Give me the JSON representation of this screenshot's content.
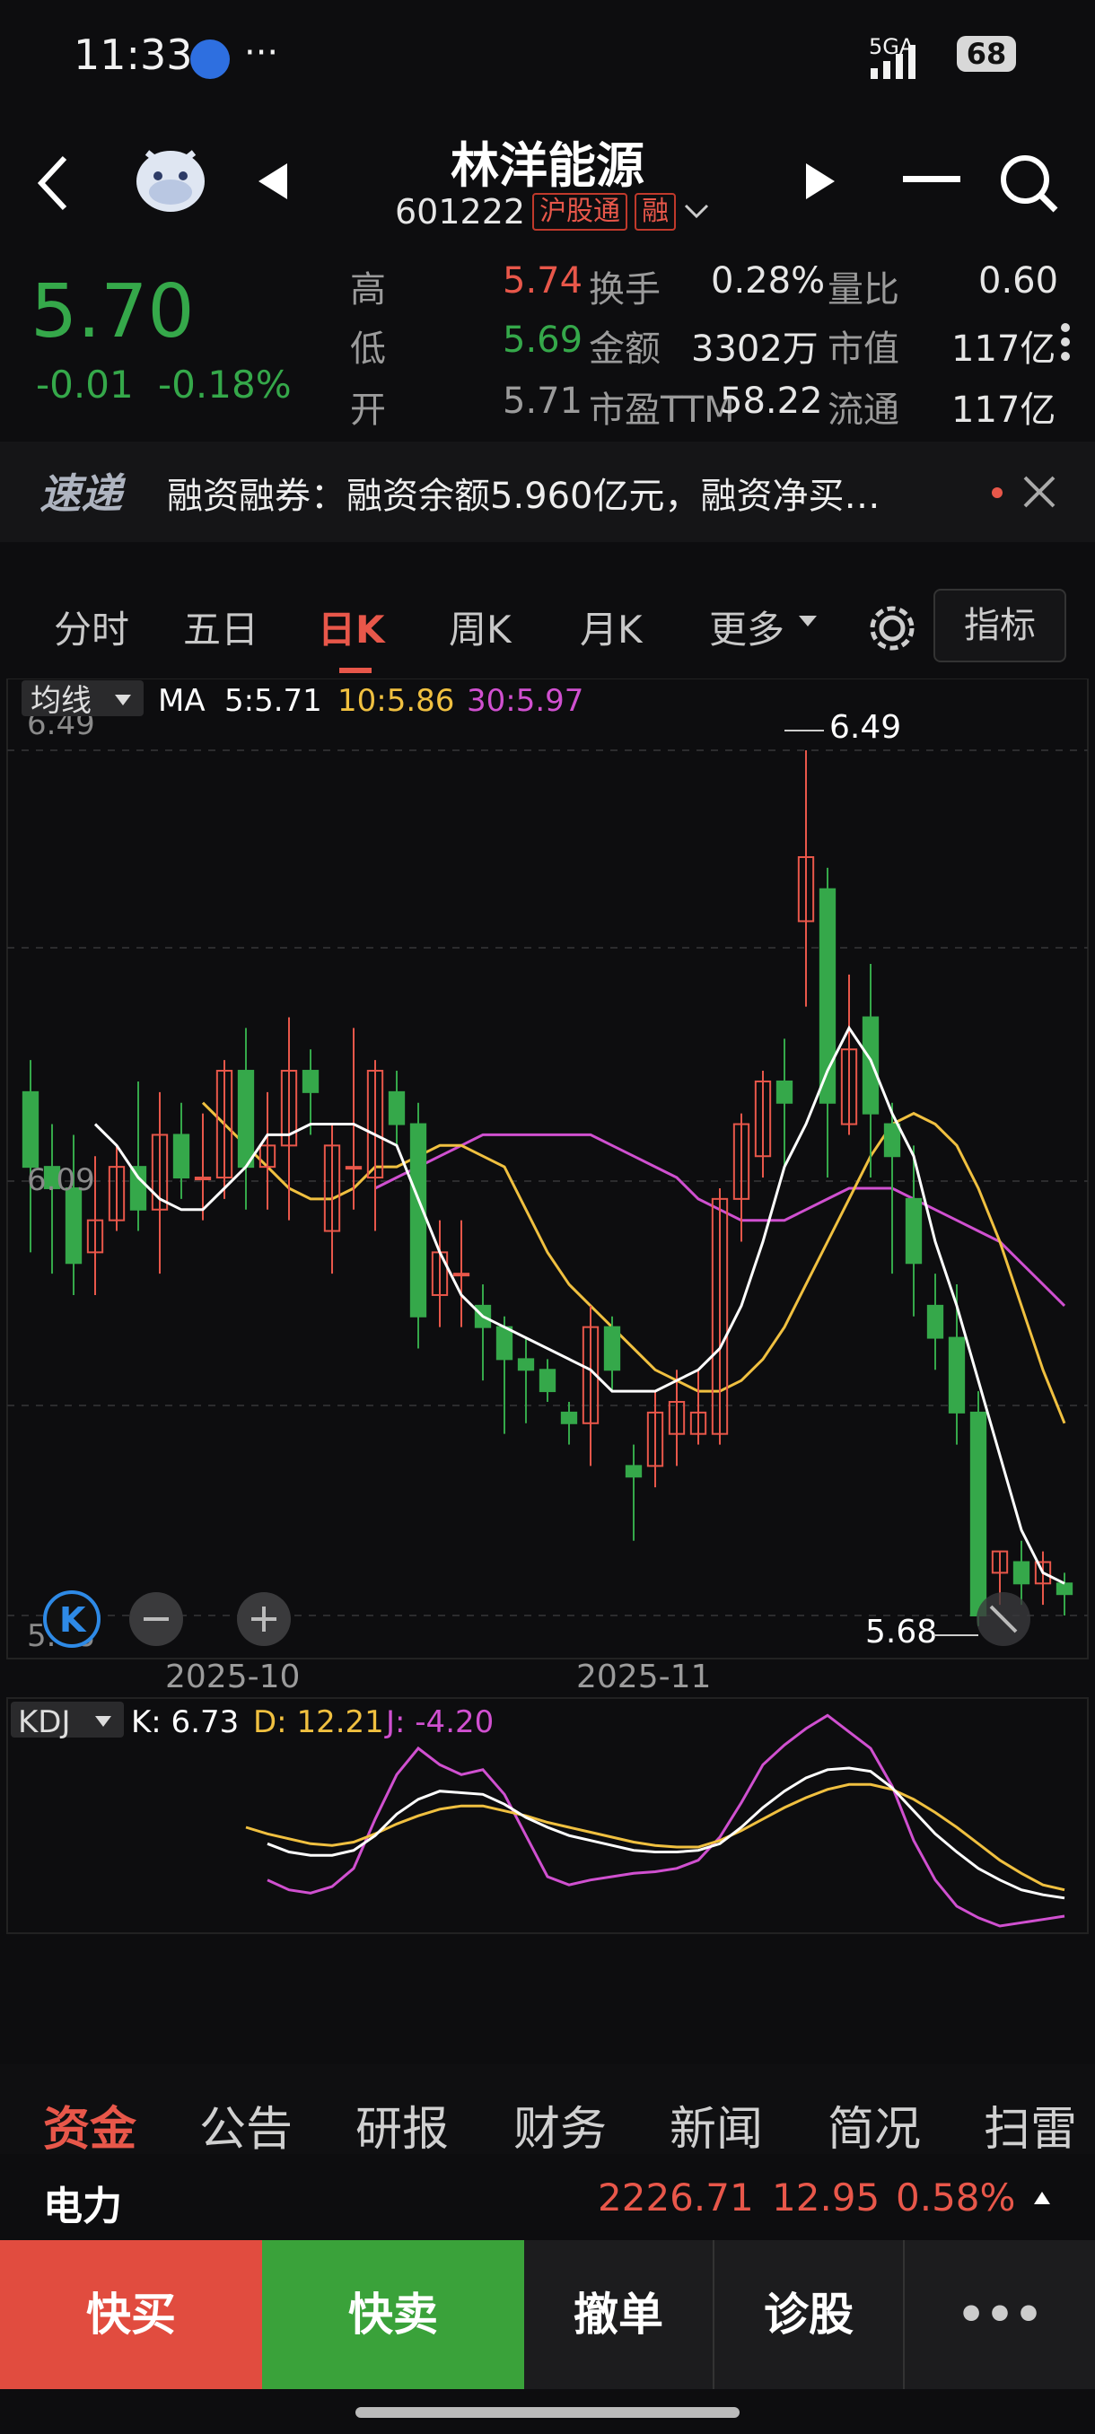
{
  "status_bar": {
    "time": "11:33",
    "dots": "···",
    "network": "5GA",
    "battery": "68"
  },
  "header": {
    "title": "林洋能源",
    "code": "601222",
    "tag_hgt": "沪股通",
    "tag_rong": "融"
  },
  "quote": {
    "price": "5.70",
    "change": "-0.01",
    "change_pct": "-0.18%",
    "rows": [
      {
        "l1": "高",
        "v1": "5.74",
        "l2": "换手",
        "v2": "0.28%",
        "l3": "量比",
        "v3": "0.60"
      },
      {
        "l1": "低",
        "v1": "5.69",
        "l2": "金额",
        "v2": "3302万",
        "l3": "市值",
        "v3": "117亿"
      },
      {
        "l1": "开",
        "v1": "5.71",
        "l2": "市盈TTM",
        "v2": "58.22",
        "l3": "流通",
        "v3": "117亿"
      }
    ]
  },
  "news": {
    "logo": "速递",
    "text": "融资融券：融资余额5.960亿元，融资净买…"
  },
  "tabs": {
    "items": [
      "分时",
      "五日",
      "日K",
      "周K",
      "月K",
      "更多"
    ],
    "active": "日K",
    "indicator_button": "指标"
  },
  "ma_legend": {
    "label": "均线",
    "ma": "MA",
    "ma5": "5:5.71",
    "ma10": "10:5.86",
    "ma30": "30:5.97"
  },
  "kdj_legend": {
    "label": "KDJ",
    "k": "K: 6.73",
    "d": "D: 12.21",
    "j": "J: -4.20"
  },
  "chart_data": {
    "type": "candlestick",
    "y_labels": [
      "6.49",
      "6.09",
      "5.68"
    ],
    "x_labels": [
      "2025-10",
      "2025-11"
    ],
    "annotations": {
      "high": "6.49",
      "low": "5.68"
    },
    "ylim": [
      5.68,
      6.49
    ],
    "colors": {
      "up": "#e8574a",
      "down": "#35a84a",
      "ma5": "#ffffff",
      "ma10": "#f0c040",
      "ma30": "#d050d0"
    },
    "candles": [
      {
        "o": 6.17,
        "h": 6.2,
        "l": 6.02,
        "c": 6.1
      },
      {
        "o": 6.1,
        "h": 6.14,
        "l": 6.0,
        "c": 6.08
      },
      {
        "o": 6.08,
        "h": 6.13,
        "l": 5.98,
        "c": 6.01
      },
      {
        "o": 6.02,
        "h": 6.11,
        "l": 5.98,
        "c": 6.05
      },
      {
        "o": 6.05,
        "h": 6.12,
        "l": 6.04,
        "c": 6.1
      },
      {
        "o": 6.1,
        "h": 6.18,
        "l": 6.04,
        "c": 6.06
      },
      {
        "o": 6.06,
        "h": 6.17,
        "l": 6.0,
        "c": 6.13
      },
      {
        "o": 6.13,
        "h": 6.16,
        "l": 6.07,
        "c": 6.09
      },
      {
        "o": 6.09,
        "h": 6.15,
        "l": 6.05,
        "c": 6.09
      },
      {
        "o": 6.09,
        "h": 6.2,
        "l": 6.07,
        "c": 6.19
      },
      {
        "o": 6.19,
        "h": 6.23,
        "l": 6.06,
        "c": 6.1
      },
      {
        "o": 6.1,
        "h": 6.17,
        "l": 6.06,
        "c": 6.12
      },
      {
        "o": 6.12,
        "h": 6.24,
        "l": 6.05,
        "c": 6.19
      },
      {
        "o": 6.19,
        "h": 6.21,
        "l": 6.13,
        "c": 6.17
      },
      {
        "o": 6.04,
        "h": 6.14,
        "l": 6.0,
        "c": 6.12
      },
      {
        "o": 6.1,
        "h": 6.23,
        "l": 6.06,
        "c": 6.1
      },
      {
        "o": 6.09,
        "h": 6.2,
        "l": 6.04,
        "c": 6.19
      },
      {
        "o": 6.17,
        "h": 6.19,
        "l": 6.12,
        "c": 6.14
      },
      {
        "o": 6.14,
        "h": 6.16,
        "l": 5.93,
        "c": 5.96
      },
      {
        "o": 5.98,
        "h": 6.05,
        "l": 5.95,
        "c": 6.02
      },
      {
        "o": 6.0,
        "h": 6.05,
        "l": 5.95,
        "c": 6.0
      },
      {
        "o": 5.97,
        "h": 5.99,
        "l": 5.9,
        "c": 5.95
      },
      {
        "o": 5.95,
        "h": 5.96,
        "l": 5.85,
        "c": 5.92
      },
      {
        "o": 5.92,
        "h": 5.94,
        "l": 5.86,
        "c": 5.91
      },
      {
        "o": 5.91,
        "h": 5.92,
        "l": 5.88,
        "c": 5.89
      },
      {
        "o": 5.87,
        "h": 5.88,
        "l": 5.84,
        "c": 5.86
      },
      {
        "o": 5.86,
        "h": 5.97,
        "l": 5.82,
        "c": 5.95
      },
      {
        "o": 5.95,
        "h": 5.96,
        "l": 5.89,
        "c": 5.91
      },
      {
        "o": 5.82,
        "h": 5.84,
        "l": 5.75,
        "c": 5.81
      },
      {
        "o": 5.82,
        "h": 5.89,
        "l": 5.8,
        "c": 5.87
      },
      {
        "o": 5.85,
        "h": 5.91,
        "l": 5.82,
        "c": 5.88
      },
      {
        "o": 5.85,
        "h": 5.91,
        "l": 5.84,
        "c": 5.87
      },
      {
        "o": 5.85,
        "h": 6.08,
        "l": 5.84,
        "c": 6.07
      },
      {
        "o": 6.07,
        "h": 6.15,
        "l": 6.03,
        "c": 6.14
      },
      {
        "o": 6.11,
        "h": 6.19,
        "l": 6.09,
        "c": 6.18
      },
      {
        "o": 6.18,
        "h": 6.22,
        "l": 6.1,
        "c": 6.16
      },
      {
        "o": 6.33,
        "h": 6.49,
        "l": 6.25,
        "c": 6.39
      },
      {
        "o": 6.36,
        "h": 6.38,
        "l": 6.09,
        "c": 6.16
      },
      {
        "o": 6.14,
        "h": 6.28,
        "l": 6.13,
        "c": 6.21
      },
      {
        "o": 6.24,
        "h": 6.29,
        "l": 6.09,
        "c": 6.15
      },
      {
        "o": 6.14,
        "h": 6.16,
        "l": 6.0,
        "c": 6.11
      },
      {
        "o": 6.07,
        "h": 6.12,
        "l": 5.96,
        "c": 6.01
      },
      {
        "o": 5.97,
        "h": 6.0,
        "l": 5.91,
        "c": 5.94
      },
      {
        "o": 5.94,
        "h": 5.99,
        "l": 5.84,
        "c": 5.87
      },
      {
        "o": 5.87,
        "h": 5.89,
        "l": 5.67,
        "c": 5.68
      },
      {
        "o": 5.72,
        "h": 5.74,
        "l": 5.69,
        "c": 5.74
      },
      {
        "o": 5.73,
        "h": 5.75,
        "l": 5.69,
        "c": 5.71
      },
      {
        "o": 5.71,
        "h": 5.74,
        "l": 5.69,
        "c": 5.73
      },
      {
        "o": 5.71,
        "h": 5.72,
        "l": 5.68,
        "c": 5.7
      }
    ],
    "ma5": [
      6.14,
      6.12,
      6.09,
      6.07,
      6.06,
      6.06,
      6.08,
      6.1,
      6.13,
      6.13,
      6.14,
      6.14,
      6.14,
      6.13,
      6.12,
      6.07,
      6.02,
      5.98,
      5.96,
      5.95,
      5.94,
      5.93,
      5.92,
      5.91,
      5.89,
      5.89,
      5.89,
      5.9,
      5.91,
      5.93,
      5.97,
      6.03,
      6.1,
      6.14,
      6.19,
      6.23,
      6.2,
      6.15,
      6.11,
      6.03,
      5.97,
      5.9,
      5.83,
      5.76,
      5.72,
      5.71
    ],
    "ma10": [
      6.16,
      6.14,
      6.12,
      6.1,
      6.08,
      6.07,
      6.07,
      6.08,
      6.1,
      6.1,
      6.11,
      6.12,
      6.12,
      6.11,
      6.1,
      6.06,
      6.02,
      5.99,
      5.97,
      5.95,
      5.93,
      5.91,
      5.9,
      5.89,
      5.89,
      5.9,
      5.92,
      5.95,
      5.99,
      6.03,
      6.07,
      6.11,
      6.14,
      6.15,
      6.14,
      6.12,
      6.08,
      6.03,
      5.97,
      5.91,
      5.86
    ],
    "ma30": [
      6.08,
      6.09,
      6.1,
      6.11,
      6.12,
      6.13,
      6.13,
      6.13,
      6.13,
      6.13,
      6.13,
      6.12,
      6.11,
      6.1,
      6.09,
      6.07,
      6.06,
      6.05,
      6.05,
      6.05,
      6.06,
      6.07,
      6.08,
      6.08,
      6.08,
      6.07,
      6.06,
      6.05,
      6.04,
      6.03,
      6.01,
      5.99,
      5.97
    ],
    "kdj": {
      "ylim": [
        -10,
        110
      ],
      "k": [
        40,
        35,
        33,
        33,
        36,
        45,
        58,
        67,
        72,
        71,
        70,
        64,
        56,
        50,
        45,
        42,
        39,
        36,
        35,
        35,
        36,
        40,
        50,
        62,
        72,
        80,
        85,
        86,
        84,
        74,
        60,
        46,
        35,
        25,
        18,
        12,
        9,
        7
      ],
      "d": [
        50,
        46,
        43,
        40,
        39,
        41,
        46,
        52,
        57,
        61,
        63,
        63,
        60,
        57,
        53,
        50,
        47,
        44,
        41,
        39,
        38,
        38,
        42,
        48,
        55,
        62,
        68,
        73,
        76,
        76,
        73,
        67,
        59,
        50,
        40,
        30,
        22,
        15,
        12
      ],
      "j": [
        18,
        12,
        10,
        14,
        25,
        55,
        82,
        98,
        88,
        82,
        85,
        70,
        45,
        20,
        15,
        18,
        20,
        22,
        23,
        25,
        30,
        44,
        65,
        88,
        100,
        110,
        118,
        108,
        98,
        75,
        42,
        18,
        2,
        -5,
        -10,
        -8,
        -6,
        -4
      ]
    }
  },
  "bottom_tabs": {
    "items": [
      "资金",
      "公告",
      "研报",
      "财务",
      "新闻",
      "简况",
      "扫雷"
    ],
    "active": "资金"
  },
  "sector": {
    "name": "电力",
    "value": "2226.71",
    "change": "12.95",
    "pct": "0.58%"
  },
  "actions": {
    "buy": "快买",
    "sell": "快卖",
    "cancel": "撤单",
    "diagnose": "诊股",
    "more": "•••"
  },
  "zoom": {
    "k_label": "K"
  }
}
